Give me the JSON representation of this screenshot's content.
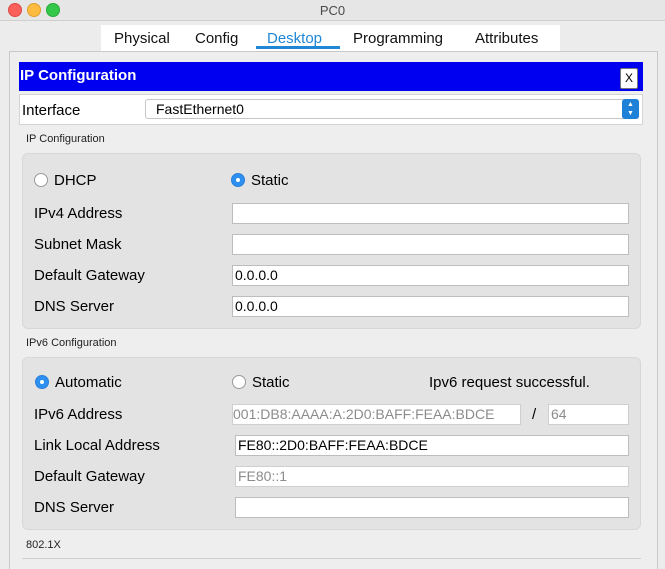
{
  "window": {
    "title": "PC0"
  },
  "tabs": [
    {
      "label": "Physical"
    },
    {
      "label": "Config"
    },
    {
      "label": "Desktop",
      "active": true
    },
    {
      "label": "Programming"
    },
    {
      "label": "Attributes"
    }
  ],
  "panel": {
    "title": "IP Configuration",
    "close_label": "X"
  },
  "interface": {
    "label": "Interface",
    "selected": "FastEthernet0"
  },
  "ipv4": {
    "section_title": "IP Configuration",
    "dhcp_label": "DHCP",
    "static_label": "Static",
    "mode": "Static",
    "fields": {
      "ipv4_address": {
        "label": "IPv4 Address",
        "value": ""
      },
      "subnet_mask": {
        "label": "Subnet Mask",
        "value": ""
      },
      "default_gateway": {
        "label": "Default Gateway",
        "value": "0.0.0.0"
      },
      "dns_server": {
        "label": "DNS Server",
        "value": "0.0.0.0"
      }
    }
  },
  "ipv6": {
    "section_title": "IPv6 Configuration",
    "automatic_label": "Automatic",
    "static_label": "Static",
    "mode": "Automatic",
    "status": "Ipv6 request successful.",
    "fields": {
      "ipv6_address": {
        "label": "IPv6 Address",
        "value": "001:DB8:AAAA:A:2D0:BAFF:FEAA:BDCE",
        "prefix": "64",
        "separator": "/"
      },
      "link_local": {
        "label": "Link Local Address",
        "value": "FE80::2D0:BAFF:FEAA:BDCE"
      },
      "default_gateway": {
        "label": "Default Gateway",
        "value": "FE80::1"
      },
      "dns_server": {
        "label": "DNS Server",
        "value": ""
      }
    }
  },
  "dot1x": {
    "section_title": "802.1X"
  },
  "colors": {
    "header_blue": "#0000f0",
    "accent": "#1f87d6"
  }
}
